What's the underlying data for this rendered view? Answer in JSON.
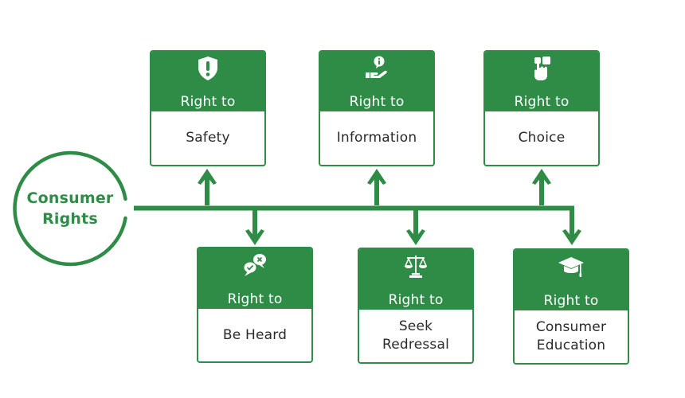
{
  "colors": {
    "accent": "#2f8c47",
    "text": "#2a2a2a",
    "background": "#ffffff"
  },
  "hub": {
    "line1": "Consumer",
    "line2": "Rights"
  },
  "rights_top": [
    {
      "prefix": "Right to",
      "label": "Safety",
      "icon": "shield-exclamation-icon"
    },
    {
      "prefix": "Right to",
      "label": "Information",
      "icon": "hand-info-icon"
    },
    {
      "prefix": "Right to",
      "label": "Choice",
      "icon": "hand-tap-icon"
    }
  ],
  "rights_bottom": [
    {
      "prefix": "Right to",
      "label": "Be Heard",
      "icon": "chat-bubbles-icon"
    },
    {
      "prefix": "Right to",
      "label_line1": "Seek",
      "label_line2": "Redressal",
      "icon": "scales-icon"
    },
    {
      "prefix": "Right to",
      "label_line1": "Consumer",
      "label_line2": "Education",
      "icon": "graduation-cap-icon"
    }
  ]
}
